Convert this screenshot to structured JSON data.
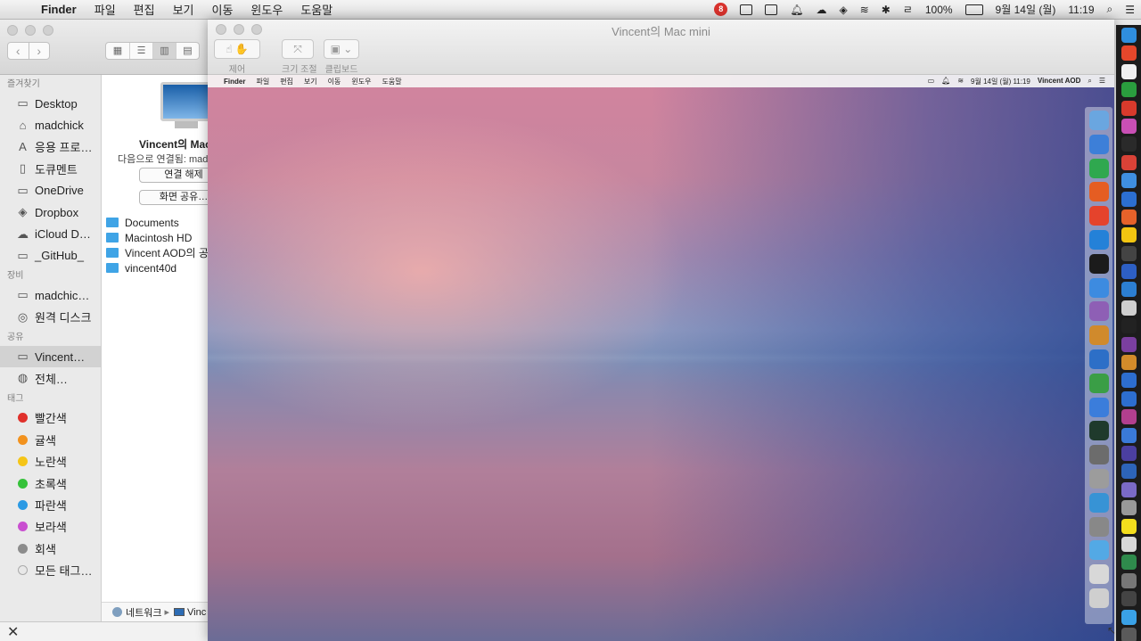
{
  "menubar": {
    "app": "Finder",
    "items": [
      "파일",
      "편집",
      "보기",
      "이동",
      "윈도우",
      "도움말"
    ],
    "status": {
      "badge": "8",
      "battery": "100%",
      "date": "9월 14일 (월)",
      "time": "11:19"
    }
  },
  "finder": {
    "sidebar": {
      "favorites_header": "즐겨찾기",
      "favorites": [
        "Desktop",
        "madchick",
        "응용 프로…",
        "도큐멘트",
        "OneDrive",
        "Dropbox",
        "iCloud D…",
        "_GitHub_"
      ],
      "devices_header": "장비",
      "devices": [
        "madchic…",
        "원격 디스크"
      ],
      "shared_header": "공유",
      "shared": [
        "Vincent…",
        "전체…"
      ],
      "tags_header": "태그",
      "tags": [
        {
          "label": "빨간색",
          "color": "#e0302b"
        },
        {
          "label": "귤색",
          "color": "#f2921e"
        },
        {
          "label": "노란색",
          "color": "#f5c518"
        },
        {
          "label": "초록색",
          "color": "#36c23a"
        },
        {
          "label": "파란색",
          "color": "#2b9ae4"
        },
        {
          "label": "보라색",
          "color": "#c94fd0"
        },
        {
          "label": "회색",
          "color": "#8c8c8c"
        },
        {
          "label": "모든 태그…",
          "color": "#e8e8e8"
        }
      ]
    },
    "main": {
      "machine_name": "Vincent의 Mac",
      "connected_as": "다음으로 연결됨: madc",
      "disconnect": "연결 해제",
      "share_screen": "화면 공유…",
      "folders": [
        "Documents",
        "Macintosh HD",
        "Vincent AOD의 공유",
        "vincent40d"
      ],
      "path": {
        "network": "네트워크",
        "separator": "▸",
        "machine": "Vinc"
      }
    }
  },
  "share_window": {
    "title": "Vincent의 Mac mini",
    "tools": [
      {
        "label": "제어",
        "icon": "pointer-icon"
      },
      {
        "label": "크기 조절",
        "icon": "resize-icon"
      },
      {
        "label": "클립보드",
        "icon": "clipboard-icon"
      }
    ],
    "remote_menubar": {
      "app": "Finder",
      "items": [
        "파일",
        "편집",
        "보기",
        "이동",
        "윈도우",
        "도움말"
      ],
      "status": [
        "9월 14일 (월) 11:19",
        "Vincent AOD"
      ]
    }
  },
  "colors": {
    "accent": "#2b9ae4",
    "wallpaper_top": "#d2839e",
    "wallpaper_bottom": "#6b6c96",
    "dock_bg": "#1c1c1c"
  },
  "remote_dock_colors": [
    "#6aa6e0",
    "#3d7fd8",
    "#2fa84f",
    "#e55d22",
    "#e5432c",
    "#2481d8",
    "#1b1b1b",
    "#3d8be0",
    "#8e5fb5",
    "#d08a2c",
    "#2d6fc7",
    "#3a9e46",
    "#3b7ddb",
    "#1f3a2c",
    "#6c6c6c",
    "#9c9c9c",
    "#3793d5",
    "#888888",
    "#53a9e5",
    "#d8d8d8",
    "#cfcfcf"
  ],
  "dock_colors": [
    "#2f8ede",
    "#e6472b",
    "#f0f0f0",
    "#2a9d3e",
    "#d83a2c",
    "#c94fb5",
    "#2a2a2a",
    "#d94237",
    "#3f8fe0",
    "#2c6fd1",
    "#e5622a",
    "#f2c511",
    "#444444",
    "#2d5fc4",
    "#2c7fd2",
    "#cfcfcf",
    "#222222",
    "#7b3fa0",
    "#d28b2a",
    "#2d6ecf",
    "#2d6ecf",
    "#b23f8e",
    "#3a7ad8",
    "#4b3fa0",
    "#2d64b8",
    "#7b6ac7",
    "#999999",
    "#f3de1d",
    "#d8d8d8",
    "#2f8a4c",
    "#777777",
    "#444444",
    "#3aa1e6",
    "#5a5a5a",
    "#bbbbbb"
  ]
}
